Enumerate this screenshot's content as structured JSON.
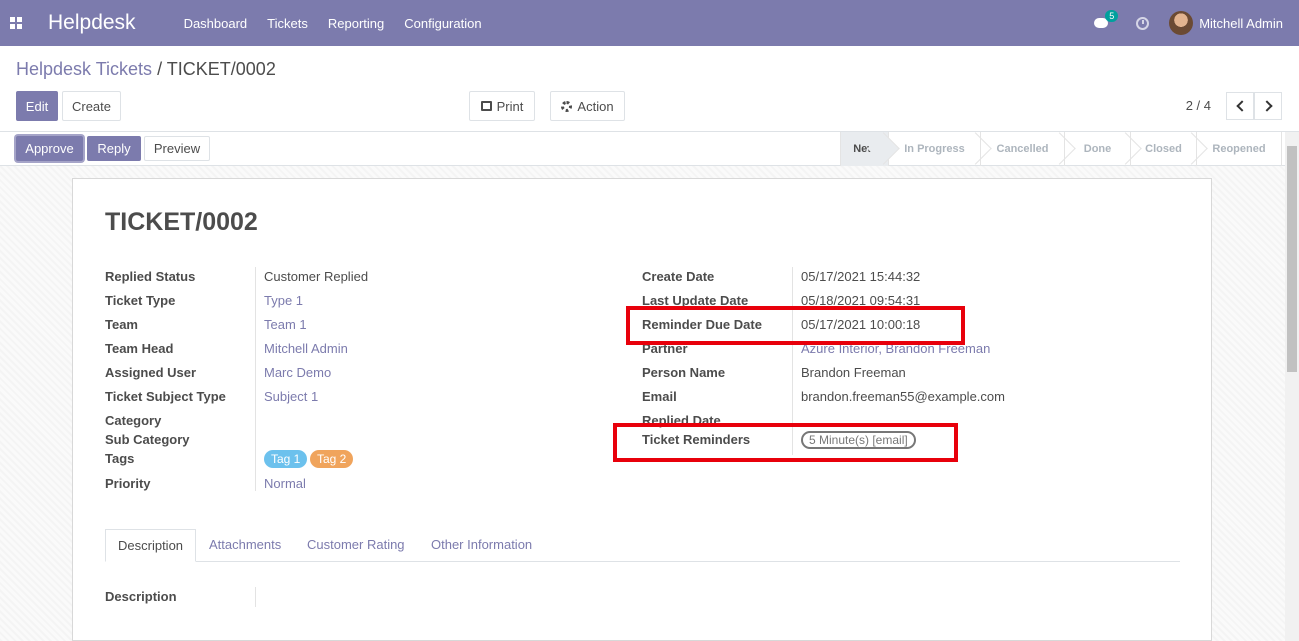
{
  "navbar": {
    "brand": "Helpdesk",
    "menu": [
      "Dashboard",
      "Tickets",
      "Reporting",
      "Configuration"
    ],
    "chat_badge": "5",
    "user_name": "Mitchell Admin",
    "bg_color": "#7c7bad"
  },
  "breadcrumb": {
    "parent": "Helpdesk Tickets",
    "separator": "/",
    "current": "TICKET/0002"
  },
  "buttons": {
    "edit": "Edit",
    "create": "Create",
    "print": "Print",
    "action": "Action"
  },
  "pager": {
    "value": "2 / 4"
  },
  "status_buttons": {
    "approve": "Approve",
    "reply": "Reply",
    "preview": "Preview"
  },
  "stages": [
    "New",
    "In Progress",
    "Cancelled",
    "Done",
    "Closed",
    "Reopened"
  ],
  "active_stage": "New",
  "ticket": {
    "title": "TICKET/0002",
    "left_fields": [
      {
        "label": "Replied Status",
        "value": "Customer Replied"
      },
      {
        "label": "Ticket Type",
        "value": "Type 1"
      },
      {
        "label": "Team",
        "value": "Team 1"
      },
      {
        "label": "Team Head",
        "value": "Mitchell Admin"
      },
      {
        "label": "Assigned User",
        "value": "Marc Demo"
      },
      {
        "label": "Ticket Subject Type",
        "value": "Subject 1"
      },
      {
        "label": "Category",
        "value": ""
      },
      {
        "label": "Sub Category",
        "value": ""
      },
      {
        "label": "Tags",
        "value": ""
      },
      {
        "label": "Priority",
        "value": "Normal"
      }
    ],
    "tags": [
      "Tag 1",
      "Tag 2"
    ],
    "right_fields": [
      {
        "label": "Create Date",
        "value": "05/17/2021 15:44:32"
      },
      {
        "label": "Last Update Date",
        "value": "05/18/2021 09:54:31"
      },
      {
        "label": "Reminder Due Date",
        "value": "05/17/2021 10:00:18"
      },
      {
        "label": "Partner",
        "value": "Azure Interior, Brandon Freeman"
      },
      {
        "label": "Person Name",
        "value": "Brandon Freeman"
      },
      {
        "label": "Email",
        "value": "brandon.freeman55@example.com"
      },
      {
        "label": "Replied Date",
        "value": ""
      },
      {
        "label": "Ticket Reminders",
        "value": "5 Minute(s) [email]"
      }
    ]
  },
  "tabs": [
    "Description",
    "Attachments",
    "Customer Rating",
    "Other Information"
  ],
  "description_label": "Description",
  "colors": {
    "accent": "#7c7bad",
    "tag1": "#6cc1ed",
    "tag2": "#f0a45c",
    "highlight": "#e8000b"
  }
}
